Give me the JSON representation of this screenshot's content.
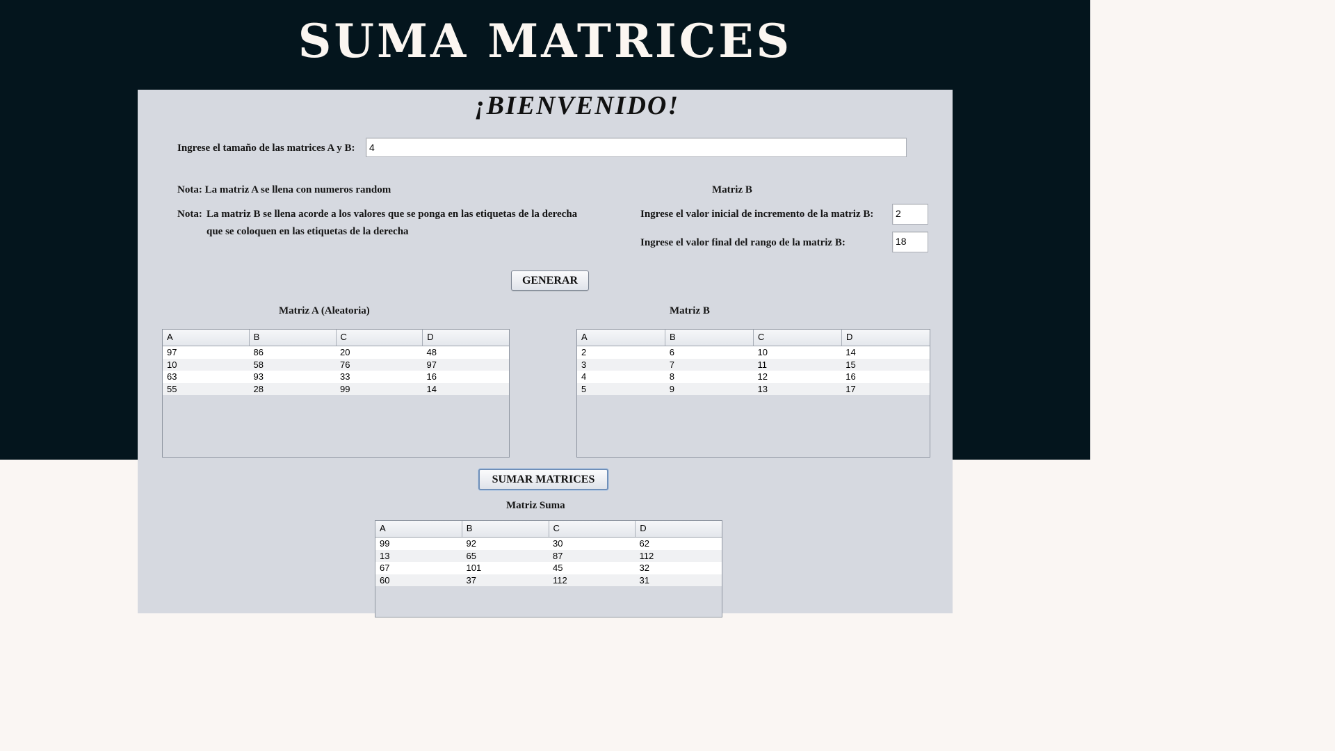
{
  "header": {
    "title": "SUMA MATRICES"
  },
  "form": {
    "welcome": "¡BIENVENIDO!",
    "size_label": "Ingrese el tamaño de las matrices A y B:",
    "size_value": "4",
    "note_a": "Nota: La matriz A se llena con numeros random",
    "note_b_prefix": "Nota:",
    "note_b_line1": "La matriz B se llena acorde a los valores que se ponga en las etiquetas de la derecha",
    "note_b_line2": "que se coloquen en las etiquetas de la derecha",
    "matrix_b_header": "Matriz B",
    "start_label": "Ingrese el valor inicial de incremento de la matriz B:",
    "start_value": "2",
    "end_label": "Ingrese el valor final del rango de la matriz B:",
    "end_value": "18",
    "generate_button": "GENERAR",
    "sum_button": "SUMAR MATRICES"
  },
  "matrix_a": {
    "caption": "Matriz A (Aleatoria)",
    "columns": [
      "A",
      "B",
      "C",
      "D"
    ],
    "rows": [
      [
        "97",
        "86",
        "20",
        "48"
      ],
      [
        "10",
        "58",
        "76",
        "97"
      ],
      [
        "63",
        "93",
        "33",
        "16"
      ],
      [
        "55",
        "28",
        "99",
        "14"
      ]
    ]
  },
  "matrix_b": {
    "caption": "Matriz B",
    "columns": [
      "A",
      "B",
      "C",
      "D"
    ],
    "rows": [
      [
        "2",
        "6",
        "10",
        "14"
      ],
      [
        "3",
        "7",
        "11",
        "15"
      ],
      [
        "4",
        "8",
        "12",
        "16"
      ],
      [
        "5",
        "9",
        "13",
        "17"
      ]
    ]
  },
  "matrix_sum": {
    "caption": "Matriz Suma",
    "columns": [
      "A",
      "B",
      "C",
      "D"
    ],
    "rows": [
      [
        "99",
        "92",
        "30",
        "62"
      ],
      [
        "13",
        "65",
        "87",
        "112"
      ],
      [
        "67",
        "101",
        "45",
        "32"
      ],
      [
        "60",
        "37",
        "112",
        "31"
      ]
    ]
  }
}
